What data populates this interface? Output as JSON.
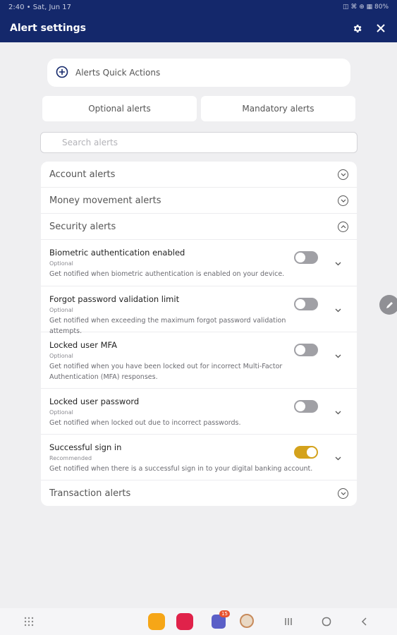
{
  "status_bar": {
    "time": "2:40 • Sat, Jun 17",
    "indicators": "▣ ◫ ▣ •",
    "right_icons": "◫ ⌘ ⊕ ▦ 80%"
  },
  "header": {
    "title": "Alert settings",
    "icons": [
      "gear-icon",
      "close-icon"
    ]
  },
  "quick_actions": {
    "label": "Alerts Quick Actions",
    "icon": "add-circle-icon"
  },
  "tabs": {
    "optional": "Optional alerts",
    "mandatory": "Mandatory alerts"
  },
  "search": {
    "placeholder": "Search alerts",
    "value": ""
  },
  "categories": {
    "account": "Account alerts",
    "money": "Money movement alerts",
    "security": "Security alerts",
    "transaction": "Transaction alerts"
  },
  "security_alerts": [
    {
      "title": "Biometric authentication enabled",
      "tag": "Optional",
      "desc": "Get notified when biometric authentication is enabled on your device.",
      "enabled": false
    },
    {
      "title": "Forgot password validation limit",
      "tag": "Optional",
      "desc": "Get notified when exceeding the maximum forgot password validation attempts.",
      "enabled": false
    },
    {
      "title": "Locked user MFA",
      "tag": "Optional",
      "desc": "Get notified when you have been locked out for incorrect Multi-Factor Authentication (MFA) responses.",
      "enabled": false
    },
    {
      "title": "Locked user password",
      "tag": "Optional",
      "desc": "Get notified when locked out due to incorrect passwords.",
      "enabled": false
    },
    {
      "title": "Successful sign in",
      "tag": "Recommended",
      "desc": "Get notified when there is a successful sign in to your digital banking account.",
      "enabled": true
    }
  ],
  "colors": {
    "header_bg": "#14286b",
    "toggle_on": "#d4a21c",
    "toggle_off": "#a0a0a5",
    "page_bg": "#efeff1"
  },
  "nav_bar": {
    "teams_badge": "15"
  }
}
